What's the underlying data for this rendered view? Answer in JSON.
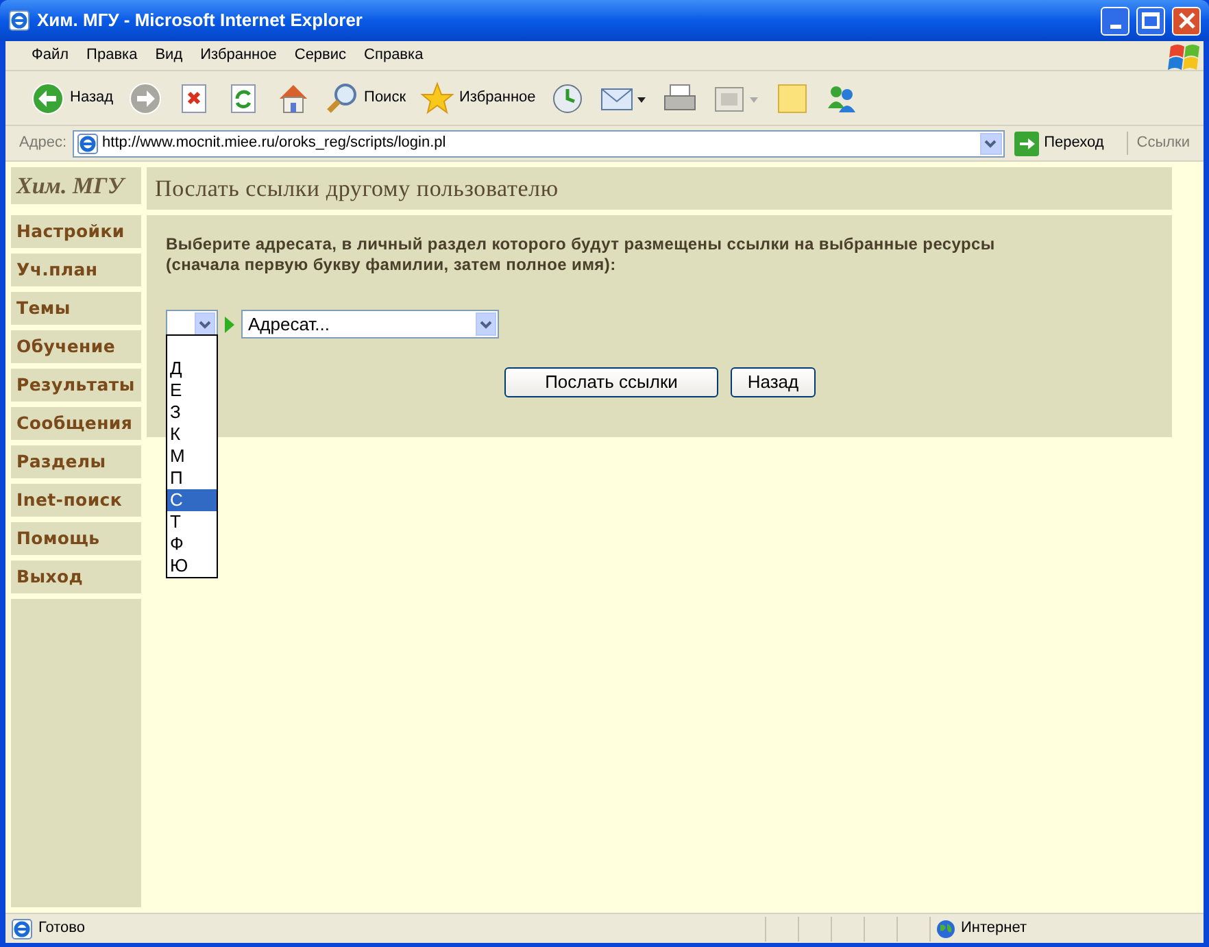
{
  "window": {
    "title": "Хим. МГУ - Microsoft Internet Explorer"
  },
  "menu": [
    "Файл",
    "Правка",
    "Вид",
    "Избранное",
    "Сервис",
    "Справка"
  ],
  "toolbar": [
    {
      "kind": "back",
      "label": "Назад"
    },
    {
      "kind": "forward"
    },
    {
      "kind": "stop"
    },
    {
      "kind": "refresh"
    },
    {
      "kind": "home"
    },
    {
      "kind": "search",
      "label": "Поиск"
    },
    {
      "kind": "favorites",
      "label": "Избранное"
    },
    {
      "kind": "history"
    },
    {
      "kind": "mail"
    },
    {
      "kind": "print"
    },
    {
      "kind": "edit"
    },
    {
      "kind": "note"
    },
    {
      "kind": "messenger"
    }
  ],
  "address_bar": {
    "label": "Адрес:",
    "url": "http://www.mocnit.miee.ru/oroks_reg/scripts/login.pl",
    "go": "Переход",
    "links": "Ссылки"
  },
  "sidebar": {
    "brand": "Хим. МГУ",
    "items": [
      "Настройки",
      "Уч.план",
      "Темы",
      "Обучение",
      "Результаты",
      "Сообщения",
      "Разделы",
      "Inet-поиск",
      "Помощь",
      "Выход"
    ]
  },
  "page": {
    "heading": "Послать ссылки другому пользователю",
    "instruction": "Выберите адресата, в личный раздел которого будут размещены ссылки на выбранные ресурсы\n(сначала первую букву фамилии, затем полное имя):",
    "letter_select": {
      "expanded": true,
      "options": [
        {
          "label": "Д",
          "selected": false
        },
        {
          "label": "Е",
          "selected": false
        },
        {
          "label": "З",
          "selected": false
        },
        {
          "label": "К",
          "selected": false
        },
        {
          "label": "М",
          "selected": false
        },
        {
          "label": "П",
          "selected": false
        },
        {
          "label": "С",
          "selected": true
        },
        {
          "label": "Т",
          "selected": false
        },
        {
          "label": "Ф",
          "selected": false
        },
        {
          "label": "Ю",
          "selected": false
        }
      ]
    },
    "addressee_select": {
      "value": "Адресат..."
    },
    "buttons": [
      "Послать ссылки",
      "Назад"
    ]
  },
  "status_bar": {
    "text": "Готово",
    "zone": "Интернет"
  }
}
